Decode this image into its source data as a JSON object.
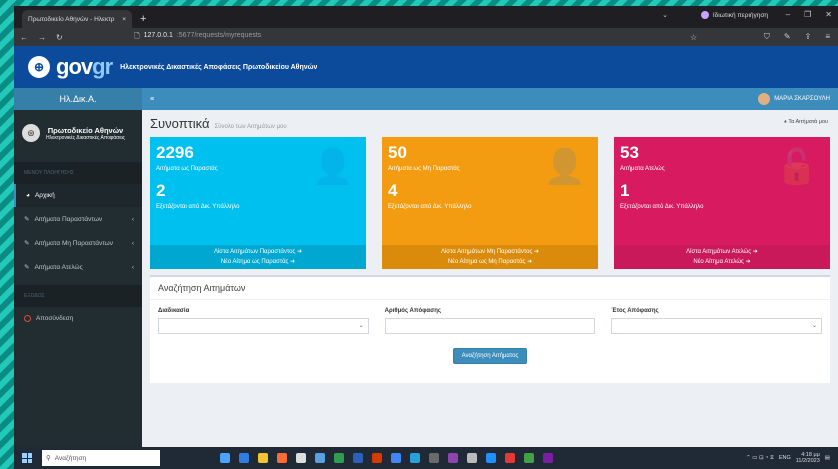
{
  "browser": {
    "tab_title": "Πρωτοδικείο Αθηνών - Ηλεκτρ",
    "tab_close": "×",
    "new_tab": "+",
    "incognito_label": "Ιδιωτική περιήγηση",
    "url_host": "127.0.0.1",
    "url_rest": ":5677/requests/myrequests"
  },
  "header": {
    "logo_text_1": "gov",
    "logo_text_2": "gr",
    "title": "Ηλεκτρονικές Δικαστικές Αποφάσεις Πρωτοδικείου Αθηνών"
  },
  "topnav": {
    "brand": "Ηλ.Δικ.Α.",
    "menu_toggle": "≡",
    "user_name": "ΜΑΡΙΑ ΣΚΑΡΣΟΥΛΗ"
  },
  "sidebar": {
    "court_name": "Πρωτοδικείο Αθηνών",
    "court_sub": "Ηλεκτρονικές Δικαστικές Αποφάσεις",
    "menu_header": "ΜΕΝΟΥ ΠΛΟΗΓΗΣΗΣ",
    "items": [
      {
        "label": "Αρχική",
        "icon": "dashboard-icon"
      },
      {
        "label": "Αιτήματα Παραστάντων",
        "icon": "edit-icon",
        "chevron": "‹"
      },
      {
        "label": "Αιτήματα Μη Παραστάντων",
        "icon": "edit-icon",
        "chevron": "‹"
      },
      {
        "label": "Αιτήματα Ατελώς",
        "icon": "edit-icon",
        "chevron": "‹"
      }
    ],
    "exit_header": "ΕΞΟΔΟΣ",
    "logout_label": "Αποσύνδεση"
  },
  "page": {
    "title": "Συνοπτικά",
    "subtitle": "Σύνολο των Αιτημάτων μου",
    "breadcrumb": "Τα Αιτήματά μου"
  },
  "boxes": [
    {
      "count": "2296",
      "label": "Αιτήματα ως Παραστάς",
      "count2": "2",
      "label2": "Εξετάζονται από Δικ. Υπάλληλο",
      "link1": "Λίστα Αιτημάτων Παραστάντος ➜",
      "link2": "Νέο Αίτημα ως Παραστάς ➜",
      "color": "#00c0ef"
    },
    {
      "count": "50",
      "label": "Αιτήματα ως Μη Παραστάς",
      "count2": "4",
      "label2": "Εξετάζονται από Δικ. Υπάλληλο",
      "link1": "Λίστα Αιτημάτων Μη Παραστάντος ➜",
      "link2": "Νέο Αίτημα ως Μη Παραστάς ➜",
      "color": "#f39c12"
    },
    {
      "count": "53",
      "label": "Αιτήματα Ατελώς",
      "count2": "1",
      "label2": "Εξετάζονται από Δικ. Υπάλληλο",
      "link1": "Λίστα Αιτημάτων Ατελώς ➜",
      "link2": "Νέο Αίτημα Ατελώς ➜",
      "color": "#d81b60"
    }
  ],
  "search": {
    "heading": "Αναζήτηση Αιτημάτων",
    "field1_label": "Διαδικασία",
    "field2_label": "Αριθμός Απόφασης",
    "field3_label": "Έτος Απόφασης",
    "button": "Αναζήτηση Αιτήματος"
  },
  "taskbar": {
    "search_placeholder": "Αναζήτηση",
    "lang": "ENG",
    "time": "4:18 μμ",
    "date": "11/2/2023"
  }
}
